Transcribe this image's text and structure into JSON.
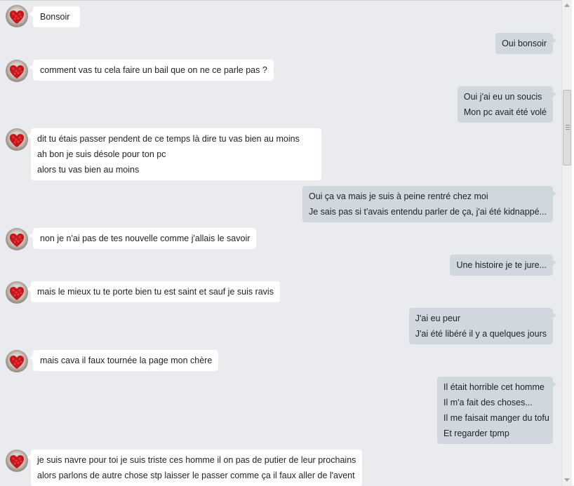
{
  "conversation": {
    "messages": [
      {
        "side": "in",
        "lines": [
          "Bonsoir"
        ]
      },
      {
        "side": "out",
        "lines": [
          "Oui bonsoir"
        ]
      },
      {
        "side": "in",
        "lines": [
          "comment vas tu cela faire un bail que on ne ce parle pas ?"
        ]
      },
      {
        "side": "out",
        "lines": [
          "Oui j'ai eu un soucis",
          "Mon pc avait été volé"
        ]
      },
      {
        "side": "in",
        "lines": [
          "dit tu étais passer pendent de ce temps là dire tu vas bien au moins",
          "ah bon je suis désole pour ton pc",
          "alors tu vas bien au moins"
        ]
      },
      {
        "side": "out",
        "lines": [
          "Oui ça va mais je suis à peine rentré chez moi",
          "Je sais pas si t'avais entendu parler de ça, j'ai été kidnappé..."
        ]
      },
      {
        "side": "in",
        "lines": [
          "non je n'ai pas de tes nouvelle comme j'allais le savoir"
        ]
      },
      {
        "side": "out",
        "lines": [
          "Une histoire je te jure..."
        ]
      },
      {
        "side": "in",
        "lines": [
          "mais le mieux tu te porte bien tu est saint et sauf je suis ravis"
        ]
      },
      {
        "side": "out",
        "lines": [
          "J'ai eu peur",
          "J'ai été libéré il y a quelques jours"
        ]
      },
      {
        "side": "in",
        "lines": [
          "mais cava il faux tournée la page mon chère"
        ]
      },
      {
        "side": "out",
        "lines": [
          "Il était horrible cet homme",
          "Il m'a fait des choses...",
          "Il me faisait manger du tofu",
          "Et regarder tpmp"
        ]
      },
      {
        "side": "in",
        "lines": [
          "je suis navre pour toi je suis triste ces homme il on pas de putier de leur prochains",
          "alors parlons de autre chose stp laisser le passer comme ça il faux aller de l'avent"
        ]
      }
    ]
  },
  "colors": {
    "background": "#e9ebee",
    "incoming_bubble": "#ffffff",
    "outgoing_bubble": "#d1d7df",
    "text": "#1d2129"
  },
  "icons": {
    "avatar": "contact-avatar-icon",
    "scroll_up": "chevron-up-icon",
    "scroll_down": "chevron-down-icon"
  }
}
